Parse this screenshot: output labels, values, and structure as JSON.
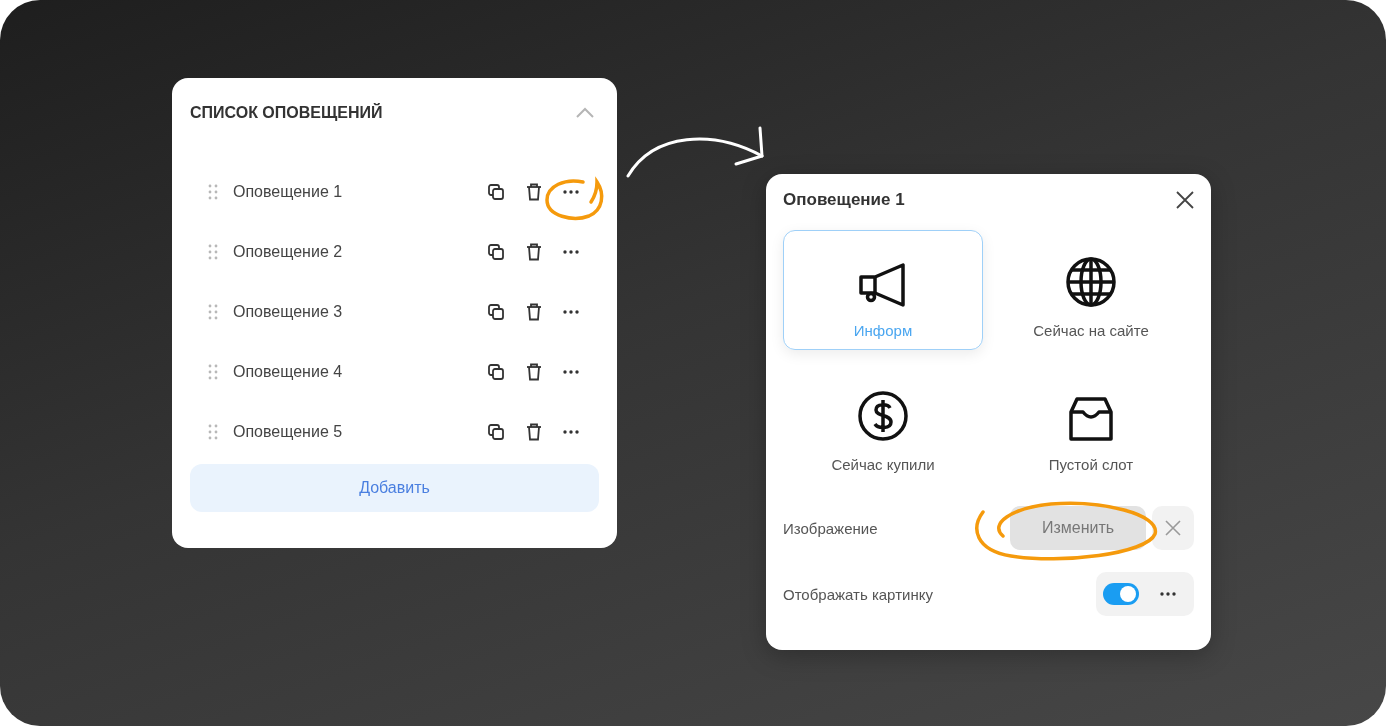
{
  "list_panel": {
    "title": "СПИСОК ОПОВЕЩЕНИЙ",
    "expanded": true,
    "items": [
      {
        "name": "Оповещение 1"
      },
      {
        "name": "Оповещение 2"
      },
      {
        "name": "Оповещение 3"
      },
      {
        "name": "Оповещение 4"
      },
      {
        "name": "Оповещение 5"
      }
    ],
    "add_button": "Добавить"
  },
  "detail_panel": {
    "title": "Оповещение 1",
    "types": [
      {
        "label": "Информ",
        "kind": "megaphone",
        "selected": true
      },
      {
        "label": "Сейчас на сайте",
        "kind": "globe",
        "selected": false
      },
      {
        "label": "Сейчас купили",
        "kind": "dollar",
        "selected": false
      },
      {
        "label": "Пустой слот",
        "kind": "tray",
        "selected": false
      }
    ],
    "image_row": {
      "label": "Изображение",
      "button": "Изменить"
    },
    "toggle_row": {
      "label": "Отображать картинку",
      "on": true
    }
  }
}
